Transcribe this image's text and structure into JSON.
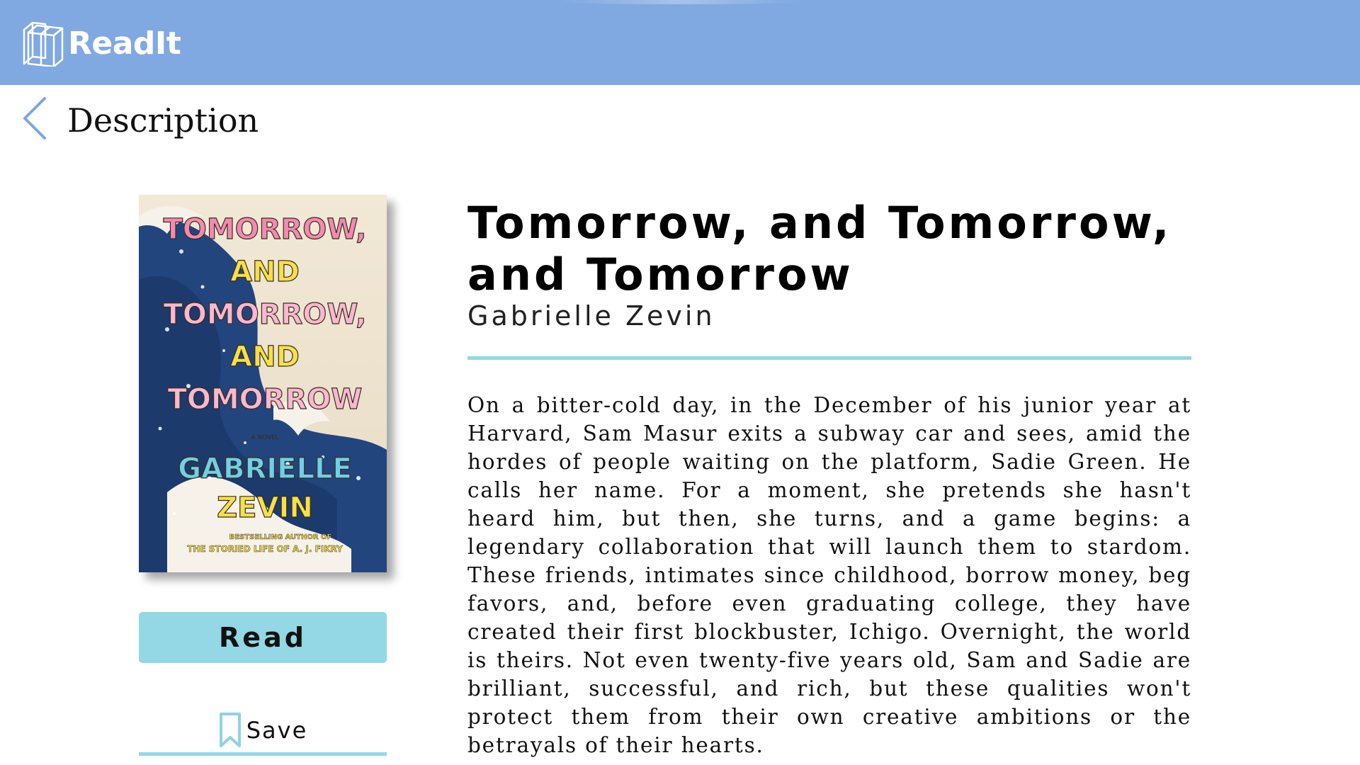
{
  "app": {
    "name": "ReadIt",
    "brand_color": "#80a9e2",
    "accent_color": "#93d8e4"
  },
  "icons": {
    "logo": "book-stack-icon",
    "back": "chevron-left-icon",
    "save": "bookmark-icon"
  },
  "page": {
    "title": "Description"
  },
  "book": {
    "title": "Tomorrow, and Tomorrow, and Tomorrow",
    "author": "Gabrielle Zevin",
    "description": "On a bitter-cold day, in the December of his junior year at Harvard, Sam Masur exits a subway car and sees, amid the hordes of people waiting on the platform, Sadie Green. He calls her name. For a moment, she pretends she hasn't heard him, but then, she turns, and a game begins: a legendary collaboration that will launch them to stardom. These friends, intimates since childhood, borrow money, beg favors, and, before even graduating college, they have created their first blockbuster, Ichigo. Overnight, the world is theirs. Not even twenty-five years old, Sam and Sadie are brilliant, successful, and rich, but these qualities won't protect them from their own creative ambitions or the betrayals of their hearts.",
    "cover": {
      "title_lines": [
        "TOMORROW,",
        "AND",
        "TOMORROW,",
        "AND",
        "TOMORROW"
      ],
      "tag": "A NOVEL",
      "author_lines": [
        "GABRIELLE",
        "ZEVIN"
      ],
      "byline_1": "BESTSELLING AUTHOR OF",
      "byline_2": "THE STORIED LIFE OF A. J. FIKRY"
    }
  },
  "actions": {
    "read_label": "Read",
    "save_label": "Save"
  }
}
